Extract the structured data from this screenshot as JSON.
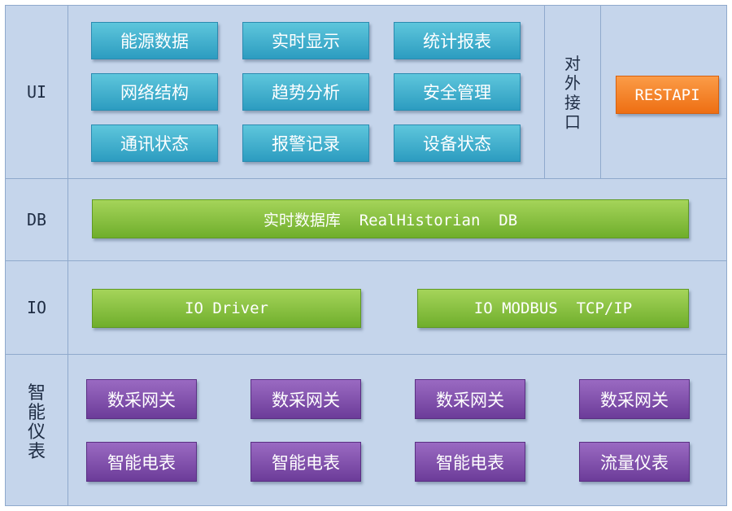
{
  "layers": {
    "ui": "UI",
    "db": "DB",
    "io": "IO",
    "meter": "智能仪表"
  },
  "ui_modules": [
    "能源数据",
    "实时显示",
    "统计报表",
    "网络结构",
    "趋势分析",
    "安全管理",
    "通讯状态",
    "报警记录",
    "设备状态"
  ],
  "external_interface": {
    "label": "对外接口",
    "api": "RESTAPI"
  },
  "db_box": "实时数据库  RealHistorian  DB",
  "io_boxes": [
    "IO Driver",
    "IO MODBUS  TCP/IP"
  ],
  "meter_row1": [
    "数采网关",
    "数采网关",
    "数采网关",
    "数采网关"
  ],
  "meter_row2": [
    "智能电表",
    "智能电表",
    "智能电表",
    "流量仪表"
  ],
  "colors": {
    "background": "#c5d5eb",
    "grid_line": "#8fa9cc",
    "ui_box": "#3aaed0",
    "db_io_box": "#86c23d",
    "meter_box": "#7e4aab",
    "api_box": "#f4801f"
  }
}
